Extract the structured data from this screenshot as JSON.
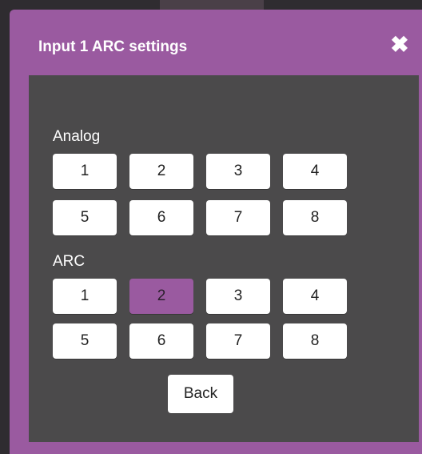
{
  "dialog": {
    "title": "Input 1 ARC settings",
    "close_glyph": "✖",
    "close_icon": "close-icon",
    "accent_color": "#9a5aa0",
    "panel_color": "#4b4a4b"
  },
  "analog": {
    "label": "Analog",
    "buttons": [
      "1",
      "2",
      "3",
      "4",
      "5",
      "6",
      "7",
      "8"
    ],
    "selected": null
  },
  "arc": {
    "label": "ARC",
    "buttons": [
      "1",
      "2",
      "3",
      "4",
      "5",
      "6",
      "7",
      "8"
    ],
    "selected": "2"
  },
  "footer": {
    "back_label": "Back"
  }
}
